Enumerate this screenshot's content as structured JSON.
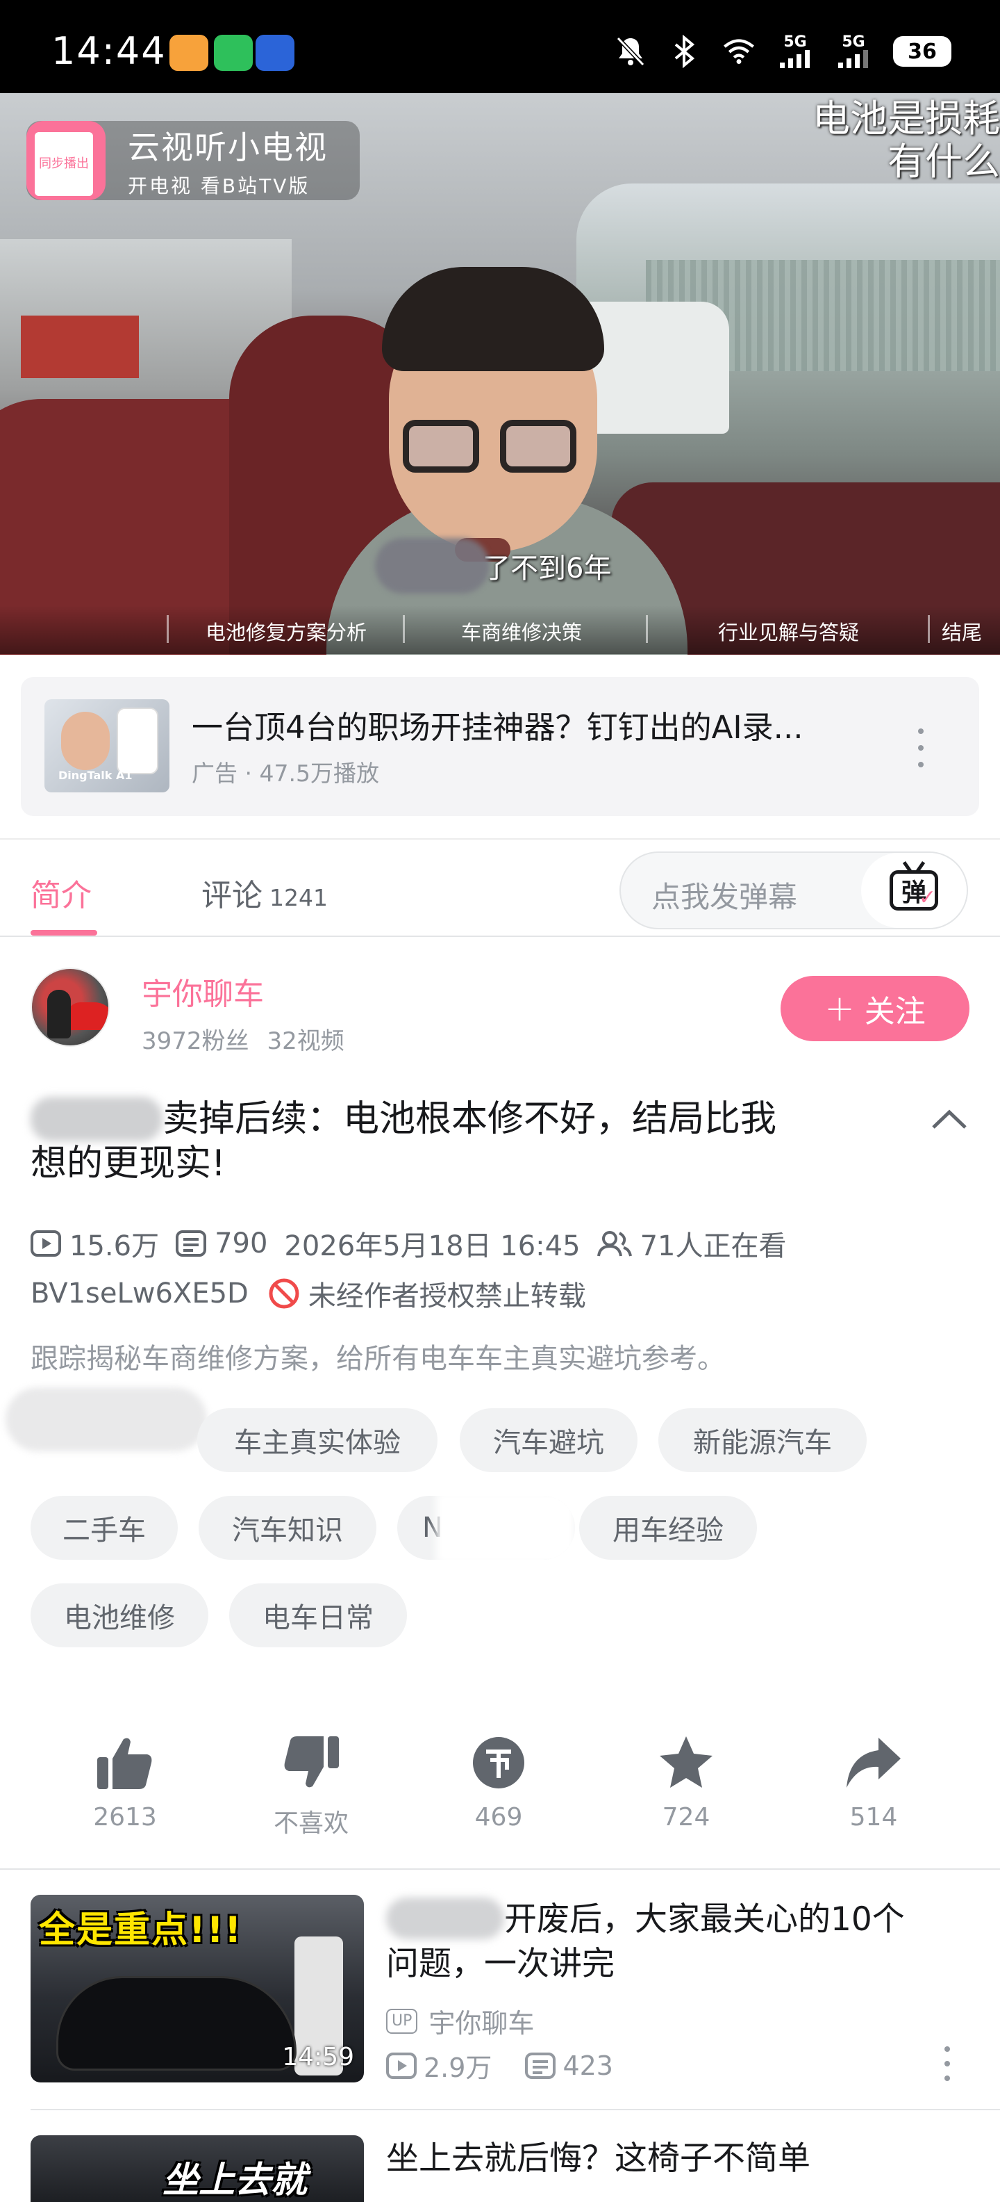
{
  "status_bar": {
    "time": "14:44",
    "network_1": "5G",
    "network_2": "5G",
    "battery": "36"
  },
  "video": {
    "logo_title": "云视听小电视",
    "logo_subtitle": "开电视 看B站TV版",
    "logo_tag": "同步播出",
    "subtitle_top_line1": "电池是损耗",
    "subtitle_top_line2": "有什么",
    "subtitle_bottom": "了不到6年",
    "chapters": [
      "电池修复方案分析",
      "车商维修决策",
      "行业见解与答疑",
      "结尾"
    ]
  },
  "ad": {
    "title": "一台顶4台的职场开挂神器？钉钉出的AI录...",
    "meta": "广告 · 47.5万播放",
    "thumb_caption": "DingTalk A1"
  },
  "tabs": {
    "intro": "简介",
    "comments": "评论",
    "comments_count": "1241",
    "danmaku_placeholder": "点我发弹幕",
    "danmaku_button": "弹"
  },
  "uploader": {
    "name": "宇你聊车",
    "fans": "3972粉丝",
    "videos": "32视频",
    "follow_label": "关注"
  },
  "video_info": {
    "title_visible": "卖掉后续：电池根本修不好，结局比我想的更现实!",
    "title_line1": "卖掉后续：电池根本修不好，结局比我",
    "title_line2": "想的更现实!",
    "views": "15.6万",
    "danmaku_count": "790",
    "date": "2026年5月18日 16:45",
    "watching": "71人正在看",
    "bvid": "BV1seLw6XE5D",
    "copyright": "未经作者授权禁止转载",
    "description": "跟踪揭秘车商维修方案，给所有电车车主真实避坑参考。"
  },
  "tags": [
    "车主真实体验",
    "汽车避坑",
    "新能源汽车",
    "二手车",
    "汽车知识",
    "N",
    "用车经验",
    "电池维修",
    "电车日常"
  ],
  "actions": {
    "like": "2613",
    "dislike": "不喜欢",
    "coin": "469",
    "favorite": "724",
    "share": "514"
  },
  "related": [
    {
      "title_line1": "开废后，大家最关心的10个",
      "title_line2": "问题，一次讲完",
      "up_badge": "UP",
      "uploader": "宇你聊车",
      "views": "2.9万",
      "danmaku": "423",
      "duration": "14:59",
      "thumb_text": "全是重点!!!"
    },
    {
      "title_line1": "坐上去就后悔？这椅子不简单",
      "thumb_text": "坐上去就"
    }
  ],
  "colors": {
    "accent": "#fb7299",
    "text_primary": "#18191c",
    "text_secondary": "#61666d",
    "text_muted": "#9499a0",
    "tag_bg": "#f1f2f3"
  },
  "icons": [
    "mute-bell-icon",
    "bluetooth-icon",
    "wifi-icon",
    "signal-icon",
    "battery-icon",
    "play-count-icon",
    "danmaku-count-icon",
    "watching-icon",
    "no-repost-icon",
    "like-icon",
    "dislike-icon",
    "coin-icon",
    "favorite-icon",
    "share-icon",
    "chevron-up-icon",
    "more-vertical-icon"
  ]
}
